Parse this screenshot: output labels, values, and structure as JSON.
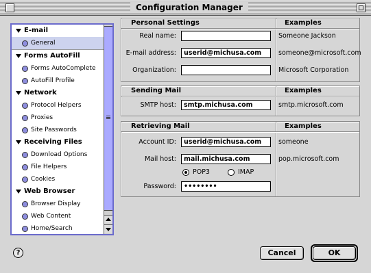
{
  "window": {
    "title": "Configuration Manager"
  },
  "sidebar": {
    "groups": [
      {
        "label": "E-mail",
        "items": [
          "General"
        ]
      },
      {
        "label": "Forms AutoFill",
        "items": [
          "Forms AutoComplete",
          "AutoFill Profile"
        ]
      },
      {
        "label": "Network",
        "items": [
          "Protocol Helpers",
          "Proxies",
          "Site Passwords"
        ]
      },
      {
        "label": "Receiving Files",
        "items": [
          "Download Options",
          "File Helpers",
          "Cookies"
        ]
      },
      {
        "label": "Web Browser",
        "items": [
          "Browser Display",
          "Web Content",
          "Home/Search"
        ]
      }
    ],
    "selected_item": "General"
  },
  "personal": {
    "title": "Personal Settings",
    "examples_title": "Examples",
    "real_name_label": "Real name:",
    "real_name_value": "",
    "real_name_example": "Someone Jackson",
    "email_label": "E-mail address:",
    "email_value": "userid@michusa.com",
    "email_example": "someone@microsoft.com",
    "org_label": "Organization:",
    "org_value": "",
    "org_example": "Microsoft Corporation"
  },
  "sending": {
    "title": "Sending Mail",
    "examples_title": "Examples",
    "smtp_label": "SMTP host:",
    "smtp_value": "smtp.michusa.com",
    "smtp_example": "smtp.microsoft.com"
  },
  "retrieving": {
    "title": "Retrieving Mail",
    "examples_title": "Examples",
    "account_label": "Account ID:",
    "account_value": "userid@michusa.com",
    "account_example": "someone",
    "mailhost_label": "Mail host:",
    "mailhost_value": "mail.michusa.com",
    "mailhost_example": "pop.microsoft.com",
    "pop3_label": "POP3",
    "imap_label": "IMAP",
    "selected_protocol": "POP3",
    "password_label": "Password:",
    "password_value": "••••••••"
  },
  "buttons": {
    "cancel": "Cancel",
    "ok": "OK",
    "help": "?"
  }
}
